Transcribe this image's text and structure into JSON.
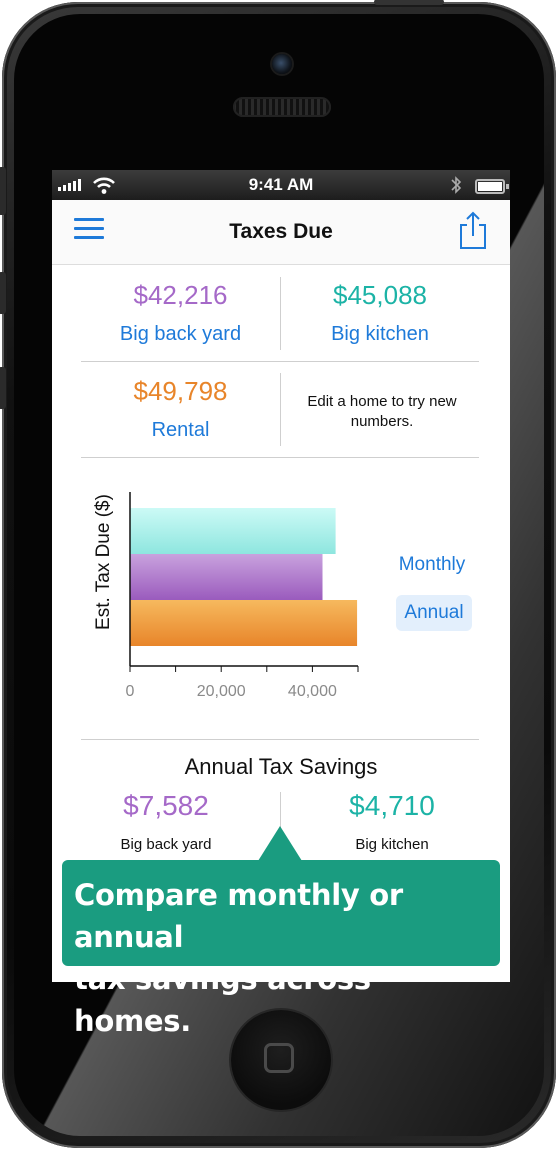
{
  "status": {
    "time": "9:41 AM"
  },
  "nav": {
    "title": "Taxes Due"
  },
  "homes": [
    {
      "amount": "$42,216",
      "name": "Big back yard",
      "color": "#a569c8"
    },
    {
      "amount": "$45,088",
      "name": "Big kitchen",
      "color": "#1cb3a6"
    },
    {
      "amount": "$49,798",
      "name": "Rental",
      "color": "#e8852a"
    }
  ],
  "hint": "Edit a home to try new numbers.",
  "toggle": {
    "monthly": "Monthly",
    "annual": "Annual",
    "selected": "Annual",
    "selected_bg": "#e3effc"
  },
  "chart_data": {
    "type": "bar",
    "orientation": "horizontal",
    "categories": [
      "Big back yard",
      "Big kitchen",
      "Rental"
    ],
    "values": [
      42216,
      45088,
      49798
    ],
    "colors": [
      "#a569c8",
      "#8ee6df",
      "#e8852a"
    ],
    "order_top_to_bottom": [
      "Big kitchen",
      "Big back yard",
      "Rental"
    ],
    "ylabel": "Est. Tax Due ($)",
    "xticks": [
      "0",
      "20,000",
      "40,000"
    ],
    "xlim": [
      0,
      50000
    ],
    "grid": false
  },
  "savings": {
    "title": "Annual Tax Savings",
    "items": [
      {
        "amount": "$7,582",
        "name": "Big back yard",
        "color": "#a569c8"
      },
      {
        "amount": "$4,710",
        "name": "Big kitchen",
        "color": "#1cb3a6"
      }
    ]
  },
  "callout": {
    "line1": "Compare monthly or annual",
    "line2": "tax savings across homes.",
    "color": "#1a9c80"
  }
}
